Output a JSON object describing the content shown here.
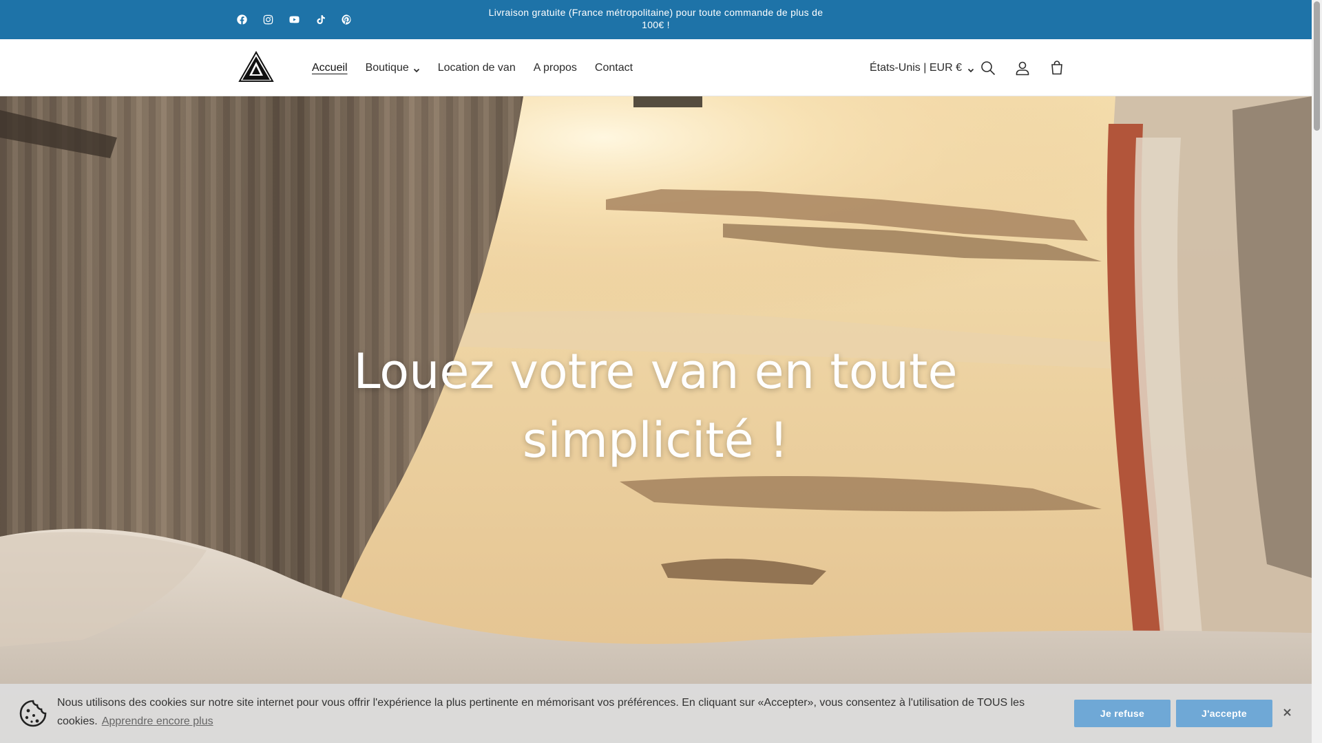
{
  "announcement": {
    "text": "Livraison gratuite (France métropolitaine) pour toute commande de plus de 100€ !",
    "social_icons": [
      "facebook-icon",
      "instagram-icon",
      "youtube-icon",
      "tiktok-icon",
      "pinterest-icon"
    ]
  },
  "header": {
    "nav": [
      {
        "label": "Accueil",
        "active": true
      },
      {
        "label": "Boutique",
        "dropdown": true
      },
      {
        "label": "Location de van"
      },
      {
        "label": "A propos"
      },
      {
        "label": "Contact"
      }
    ],
    "locale": "États-Unis | EUR €",
    "icons": [
      "search-icon",
      "account-icon",
      "cart-icon"
    ]
  },
  "hero": {
    "title": "Louez votre van en toute simplicité !"
  },
  "cookie_banner": {
    "text": "Nous utilisons des cookies sur notre site internet pour vous offrir l'expérience la plus pertinente en mémorisant vos préférences. En cliquant sur «Accepter», vous consentez à l'utilisation de TOUS les cookies.",
    "link": "Apprendre encore plus",
    "refuse_label": "Je refuse",
    "accept_label": "J'accepte"
  },
  "colors": {
    "announcement_bg": "#1e73a8",
    "button_bg": "#6fa8d6"
  }
}
